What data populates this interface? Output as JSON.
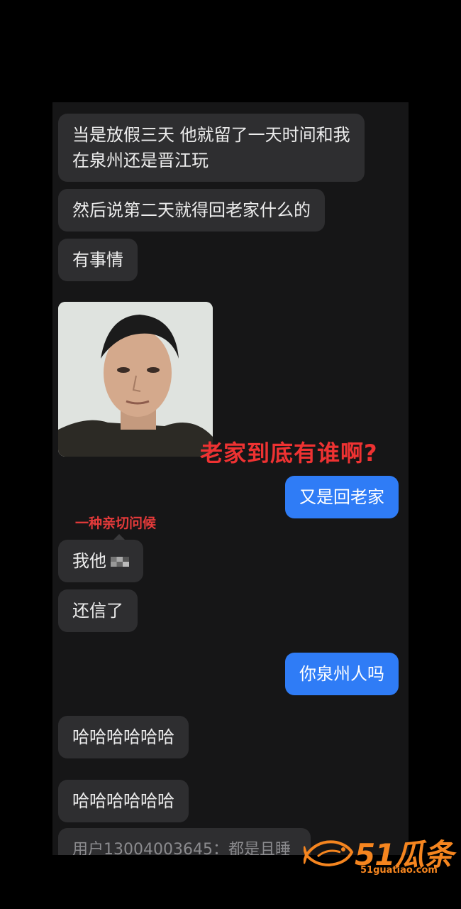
{
  "messages": {
    "m1_line1": "当是放假三天 他就留了一天时间和我",
    "m1_line2": "在泉州还是晋江玩",
    "m2": "然后说第二天就得回老家什么的",
    "m3": "有事情",
    "m4_out": "又是回老家",
    "m5": "我他",
    "m6": "还信了",
    "m7_out": "你泉州人吗",
    "m8": "哈哈哈哈哈哈",
    "m9": "哈哈哈哈哈哈",
    "m10_partial": "用户13004003645：都是且睡"
  },
  "captions": {
    "big": "老家到底有谁啊?",
    "small": "一种亲切问候"
  },
  "watermark": {
    "title": "51瓜条",
    "url": "51guatiao.com"
  },
  "colors": {
    "incoming_bubble": "#2e2e30",
    "outgoing_bubble": "#2f7cf6",
    "caption_red": "#ee3232",
    "watermark_orange": "#f5851f"
  }
}
